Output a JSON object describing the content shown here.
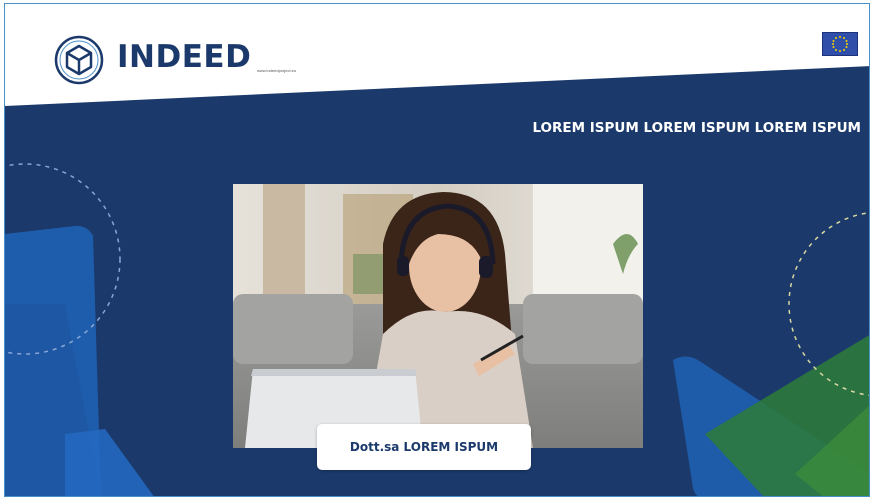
{
  "header": {
    "brand_name": "INDEED",
    "brand_url": "www.indeedproject.eu",
    "logo_icon": "cube-hexagon-icon",
    "flag_icon": "eu-flag-icon"
  },
  "main": {
    "headline": "LOREM ISPUM LOREM ISPUM LOREM ISPUM",
    "photo": "woman-with-headset-laptop-photo",
    "caption": "Dott.sa LOREM ISPUM"
  },
  "colors": {
    "navy": "#1b3a6b",
    "blue_accent": "#1f5fb0",
    "green_accent": "#2e7d3a",
    "white": "#ffffff"
  }
}
